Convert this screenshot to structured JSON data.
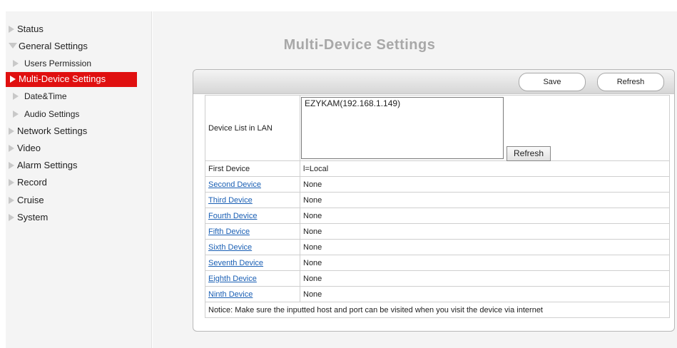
{
  "sidebar": {
    "items": [
      {
        "label": "Status"
      },
      {
        "label": "General Settings"
      },
      {
        "label": "Users Permission"
      },
      {
        "label": "Multi-Device Settings"
      },
      {
        "label": "Date&Time"
      },
      {
        "label": "Audio Settings"
      },
      {
        "label": "Network Settings"
      },
      {
        "label": "Video"
      },
      {
        "label": "Alarm Settings"
      },
      {
        "label": "Record"
      },
      {
        "label": "Cruise"
      },
      {
        "label": "System"
      }
    ],
    "active_color": "#e01010"
  },
  "main": {
    "title": "Multi-Device Settings",
    "toolbar": {
      "save_label": "Save",
      "refresh_label": "Refresh"
    },
    "device_list": {
      "label": "Device List in LAN",
      "entries": [
        "EZYKAM(192.168.1.149)"
      ],
      "refresh_label": "Refresh"
    },
    "devices": [
      {
        "label": "First Device",
        "value": "l=Local"
      },
      {
        "label": "Second Device",
        "value": "None"
      },
      {
        "label": "Third Device",
        "value": "None"
      },
      {
        "label": "Fourth Device",
        "value": "None"
      },
      {
        "label": "Fifth Device",
        "value": "None"
      },
      {
        "label": "Sixth Device",
        "value": "None"
      },
      {
        "label": "Seventh Device",
        "value": "None"
      },
      {
        "label": "Eighth Device",
        "value": "None"
      },
      {
        "label": "Ninth Device",
        "value": "None"
      }
    ],
    "notice": "Notice: Make sure the inputted host and port can be visited when you visit the device via internet",
    "link_color": "#1a5fb4"
  }
}
